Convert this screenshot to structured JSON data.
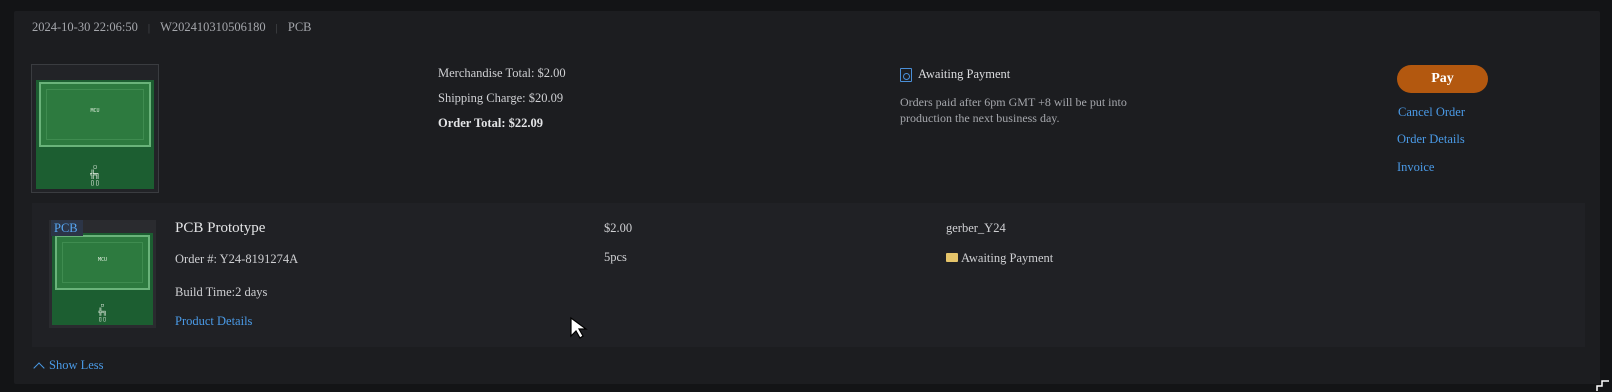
{
  "order": {
    "datetime": "2024-10-30 22:06:50",
    "order_no": "W202410310506180",
    "category": "PCB",
    "separator": "|"
  },
  "totals": {
    "merchandise": "Merchandise Total: $2.00",
    "shipping": "Shipping Charge: $20.09",
    "order_total": "Order Total: $22.09"
  },
  "status": {
    "icon": "search-document-icon",
    "label": "Awaiting Payment",
    "note": "Orders paid after 6pm GMT +8 will be put into production the next business day."
  },
  "actions": {
    "pay": "Pay",
    "cancel": "Cancel Order",
    "details": "Order Details",
    "invoice": "Invoice"
  },
  "item": {
    "badge": "PCB",
    "title": "PCB Prototype",
    "order_number": "Order #: Y24-8191274A",
    "build_time": "Build Time:2 days",
    "product_details_link": "Product Details",
    "price": "$2.00",
    "quantity": "5pcs",
    "file": "gerber_Y24",
    "status_icon": "folder-icon",
    "status": "Awaiting Payment"
  },
  "footer": {
    "show_less": "Show Less"
  },
  "colors": {
    "accent_link": "#4a9ae6",
    "pay_button": "#b3580f",
    "pcb_green": "#2d7a3f"
  }
}
